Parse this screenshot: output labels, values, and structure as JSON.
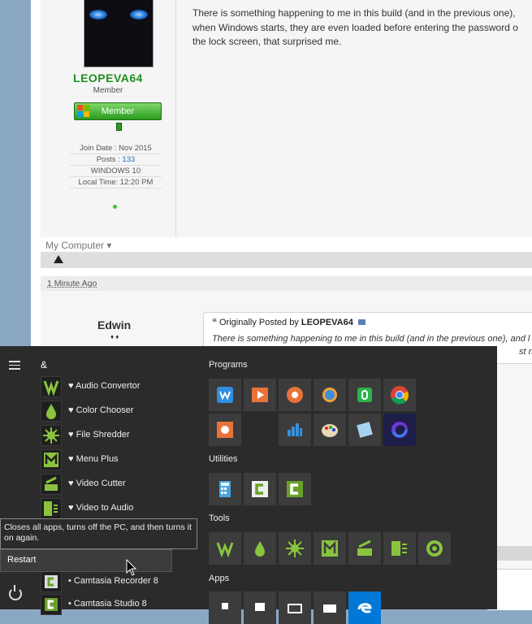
{
  "forum": {
    "post1": {
      "username": "LEOPEVA64",
      "role": "Member",
      "badge": "Member",
      "join_date": "Join Date : Nov 2015",
      "posts_label": "Posts : ",
      "posts_value": "133",
      "os": "WINDOWS 10",
      "local_time": "Local Time: 12:20 PM",
      "body_lines": [
        "There is something happening to me in this build (and in the previous one),",
        "when Windows starts, they are even loaded before entering the password o",
        "the lock screen, that surprised me."
      ],
      "my_computer": "My Computer"
    },
    "post2": {
      "timestamp": "1 Minute Ago",
      "username": "Edwin",
      "rank_marks": "♦ ♦",
      "quote_prefix": "Originally Posted by ",
      "quote_author": "LEOPEVA64",
      "quote_text_lines": [
        "There is something happening to me in this build (and in the previous one), and l",
        "st night l"
      ]
    }
  },
  "start_menu": {
    "group_letter": "&",
    "apps": [
      {
        "label": "♥ Audio Convertor",
        "icon": "audio-convertor-icon"
      },
      {
        "label": "♥ Color Chooser",
        "icon": "color-chooser-icon"
      },
      {
        "label": "♥ File Shredder",
        "icon": "file-shredder-icon"
      },
      {
        "label": "♥ Menu Plus",
        "icon": "menu-plus-icon"
      },
      {
        "label": "♥ Video Cutter",
        "icon": "video-cutter-icon"
      },
      {
        "label": "♥ Video to Audio",
        "icon": "video-to-audio-icon"
      }
    ],
    "apps_lower": [
      {
        "label": "• Camtasia Recorder 8",
        "icon": "camtasia-recorder-icon"
      },
      {
        "label": "• Camtasia Studio 8",
        "icon": "camtasia-studio-icon"
      }
    ],
    "sections": {
      "programs": "Programs",
      "utilities": "Utilities",
      "tools": "Tools",
      "apps": "Apps"
    },
    "tooltip": "Closes all apps, turns off the PC, and then turns it on again.",
    "restart_label": "Restart",
    "colors": {
      "accent_green": "#6aa02a",
      "badge_green": "#2a9b1e",
      "edge_blue": "#0078d7"
    }
  }
}
